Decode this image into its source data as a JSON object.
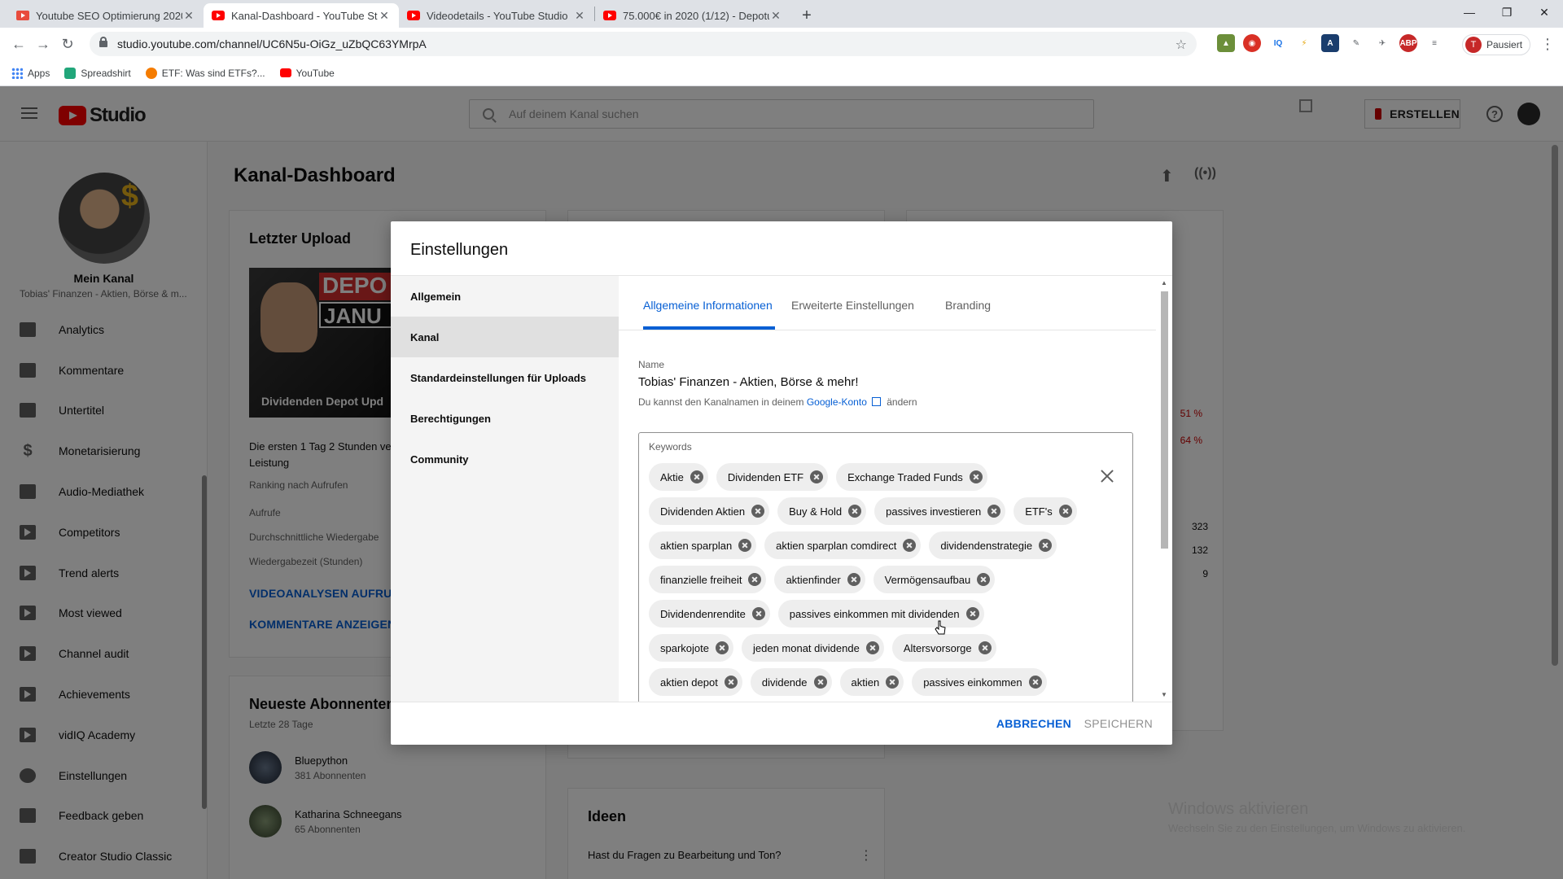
{
  "browser": {
    "tabs": [
      {
        "title": "Youtube SEO Optimierung 2020",
        "active": false
      },
      {
        "title": "Kanal-Dashboard - YouTube Stu",
        "active": true
      },
      {
        "title": "Videodetails - YouTube Studio",
        "active": false
      },
      {
        "title": "75.000€ in 2020 (1/12) - Depotu",
        "active": false
      }
    ],
    "url": "studio.youtube.com/channel/UC6N5u-OiGz_uZbQC63YMrpA",
    "profile_label": "Pausiert",
    "profile_initial": "T",
    "bookmarks": [
      {
        "label": "Apps"
      },
      {
        "label": "Spreadshirt"
      },
      {
        "label": "ETF: Was sind ETFs?..."
      },
      {
        "label": "YouTube"
      }
    ]
  },
  "studio": {
    "logo_text": "Studio",
    "search_placeholder": "Auf deinem Kanal suchen",
    "create_label": "ERSTELLEN",
    "channel": {
      "name": "Mein Kanal",
      "subtitle": "Tobias' Finanzen - Aktien, Börse & m..."
    },
    "nav": [
      {
        "label": "Analytics"
      },
      {
        "label": "Kommentare"
      },
      {
        "label": "Untertitel"
      },
      {
        "label": "Monetarisierung"
      },
      {
        "label": "Audio-Mediathek"
      },
      {
        "label": "Competitors"
      },
      {
        "label": "Trend alerts"
      },
      {
        "label": "Most viewed"
      },
      {
        "label": "Channel audit"
      },
      {
        "label": "Achievements"
      },
      {
        "label": "vidIQ Academy"
      },
      {
        "label": "Einstellungen"
      },
      {
        "label": "Feedback geben"
      },
      {
        "label": "Creator Studio Classic"
      }
    ],
    "dashboard": {
      "title": "Kanal-Dashboard",
      "last_upload": {
        "title": "Letzter Upload",
        "thumb_top": "DEPO",
        "thumb_mid": "JANU",
        "thumb_caption": "Dividenden Depot Upd",
        "desc": "Die ersten 1 Tag 2 Stunden ver Leistung",
        "rows": [
          "Ranking nach Aufrufen",
          "Aufrufe",
          "Durchschnittliche Wiedergabe",
          "Wiedergabezeit (Stunden)"
        ],
        "link1": "VIDEOANALYSEN AUFRUFE",
        "link2": "KOMMENTARE ANZEIGEN ("
      },
      "stats": {
        "pct1": "51 %",
        "pct2": "64 %",
        "v1": "323",
        "v2": "132",
        "v3": "9"
      },
      "subscribers": {
        "title": "Neueste Abonnenten",
        "period": "Letzte 28 Tage",
        "items": [
          {
            "name": "Bluepython",
            "count": "381 Abonnenten"
          },
          {
            "name": "Katharina Schneegans",
            "count": "65 Abonnenten"
          }
        ]
      },
      "ideas": {
        "title": "Ideen",
        "question": "Hast du Fragen zu Bearbeitung und Ton?"
      }
    }
  },
  "dialog": {
    "title": "Einstellungen",
    "side": [
      {
        "label": "Allgemein",
        "selected": false
      },
      {
        "label": "Kanal",
        "selected": true
      },
      {
        "label": "Standardeinstellungen für Uploads",
        "selected": false
      },
      {
        "label": "Berechtigungen",
        "selected": false
      },
      {
        "label": "Community",
        "selected": false
      }
    ],
    "tabs": [
      {
        "label": "Allgemeine Informationen",
        "active": true
      },
      {
        "label": "Erweiterte Einstellungen",
        "active": false
      },
      {
        "label": "Branding",
        "active": false
      }
    ],
    "name_label": "Name",
    "name_value": "Tobias' Finanzen - Aktien, Börse & mehr!",
    "name_help_prefix": "Du kannst den Kanalnamen in deinem",
    "name_help_link": "Google-Konto",
    "name_help_suffix": "ändern",
    "keywords_label": "Keywords",
    "keyword_rows": [
      [
        "Aktie",
        "Dividenden ETF",
        "Exchange Traded Funds"
      ],
      [
        "Dividenden Aktien",
        "Buy & Hold",
        "passives investieren",
        "ETF's"
      ],
      [
        "aktien sparplan",
        "aktien sparplan comdirect",
        "dividendenstrategie"
      ],
      [
        "finanzielle freiheit",
        "aktienfinder",
        "Vermögensaufbau"
      ],
      [
        "Dividendenrendite",
        "passives einkommen mit dividenden"
      ],
      [
        "sparkojote",
        "jeden monat dividende",
        "Altersvorsorge"
      ],
      [
        "aktien depot",
        "dividende",
        "aktien",
        "passives einkommen"
      ]
    ],
    "cancel_label": "ABBRECHEN",
    "save_label": "SPEICHERN"
  },
  "windows_notice": {
    "title": "Windows aktivieren",
    "text": "Wechseln Sie zu den Einstellungen, um Windows zu aktivieren."
  }
}
